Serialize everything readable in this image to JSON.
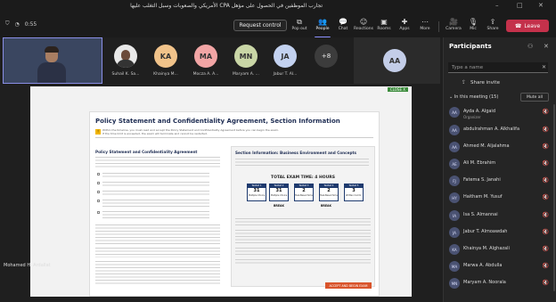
{
  "meeting": {
    "title": "تجارب الموظفين في الحصول على مؤهل CPA الأمريكي والصعوبات وسبل التغلب عليها"
  },
  "window_controls": [
    "–",
    "□",
    "✕"
  ],
  "toolbar": {
    "shield": "⛉",
    "timer": "◔",
    "time": "0:55",
    "request_control": "Request control",
    "items": [
      {
        "label": "Pop out",
        "glyph": "⧉"
      },
      {
        "label": "People",
        "glyph": "👥"
      },
      {
        "label": "Chat",
        "glyph": "💬"
      },
      {
        "label": "Reactions",
        "glyph": "☺"
      },
      {
        "label": "Rooms",
        "glyph": "▣"
      },
      {
        "label": "Apps",
        "glyph": "✚"
      },
      {
        "label": "More",
        "glyph": "⋯"
      },
      {
        "label": "Camera",
        "glyph": "🎥"
      },
      {
        "label": "Mic",
        "glyph": "🎙"
      },
      {
        "label": "Share",
        "glyph": "⇪"
      }
    ],
    "leave_label": "Leave"
  },
  "participants_strip": [
    {
      "initials": "",
      "name": "Suhail K. Sa...",
      "color": "#e8e8e8"
    },
    {
      "initials": "KA",
      "name": "Khainya M...",
      "color": "#f1c38a"
    },
    {
      "initials": "MA",
      "name": "Mocza A. A...",
      "color": "#f2a5a5"
    },
    {
      "initials": "MN",
      "name": "Maryam A. ...",
      "color": "#c9d6a6"
    },
    {
      "initials": "JA",
      "name": "Jabur T. Al...",
      "color": "#c3d2f0"
    }
  ],
  "more_count": "+8",
  "side_tile": {
    "initials": "AA"
  },
  "self": {
    "name": "Mohamed H. Ardallat"
  },
  "shared_screen": {
    "tag": "CLOSE X",
    "title": "Policy Statement and Confidentiality Agreement, Section Information",
    "warning": "Within the timeline, you must read and accept the Policy Statement and Confidentiality Agreement before you can begin the exam. If the time limit is exceeded, the exam will terminate and cannot be restarted.",
    "left_heading": "Policy Statement and Confidentiality Agreement",
    "right_heading": "Section Information: Business Environment and Concepts",
    "exam_time": "TOTAL EXAM TIME: 4 HOURS",
    "testlets": [
      {
        "label": "Testlet 1",
        "num": "31",
        "cap": "Multiple Choice"
      },
      {
        "label": "Testlet 2",
        "num": "31",
        "cap": "Multiple Choice"
      },
      {
        "label": "Testlet 3",
        "num": "2",
        "cap": "Task-Based Sims"
      },
      {
        "label": "Testlet 4",
        "num": "2",
        "cap": "Task-Based Sims"
      },
      {
        "label": "Testlet 5",
        "num": "3",
        "cap": "Written Comm."
      }
    ],
    "break_labels": [
      "BREAK",
      "BREAK"
    ],
    "accept_button": "ACCEPT AND BEGIN EXAM"
  },
  "panel": {
    "title": "Participants",
    "search_placeholder": "Type a name",
    "share_invite": "Share invite",
    "in_meeting": "In this meeting (15)",
    "mute_all": "Mute all",
    "people": [
      {
        "initials": "AA",
        "name": "Ayda A. Algaid",
        "role": "Organizer"
      },
      {
        "initials": "AA",
        "name": "abdulrahman A. Alkhalifa",
        "role": ""
      },
      {
        "initials": "AA",
        "name": "Ahmed M. Aljalahma",
        "role": ""
      },
      {
        "initials": "AE",
        "name": "Ali M. Ebrahim",
        "role": ""
      },
      {
        "initials": "FJ",
        "name": "Fatema S. Janahi",
        "role": ""
      },
      {
        "initials": "HY",
        "name": "Haitham M. Yusuf",
        "role": ""
      },
      {
        "initials": "IA",
        "name": "Isa S. Almannai",
        "role": ""
      },
      {
        "initials": "JA",
        "name": "Jabur T. Almoawdah",
        "role": ""
      },
      {
        "initials": "KA",
        "name": "Khainya M. Alghazali",
        "role": ""
      },
      {
        "initials": "MA",
        "name": "Marwa A. Abdulla",
        "role": ""
      },
      {
        "initials": "MN",
        "name": "Maryam A. Noorala",
        "role": ""
      }
    ]
  }
}
